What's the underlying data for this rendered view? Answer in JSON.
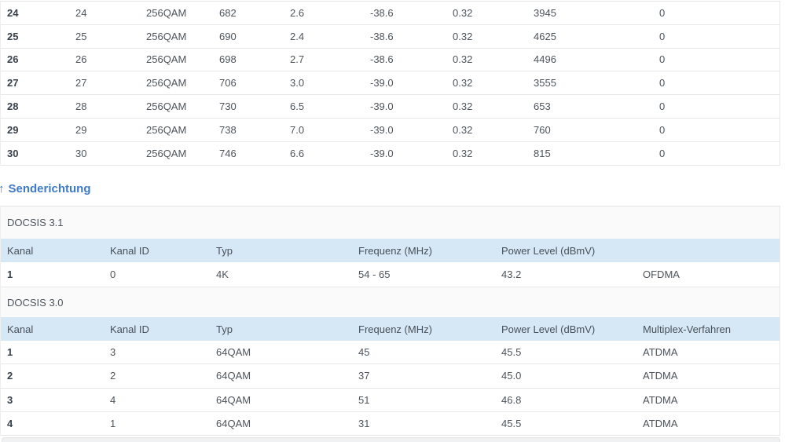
{
  "colors": {
    "table_header_bg": "#d6e8f5",
    "heading_blue": "#3d7ac7"
  },
  "downstream": {
    "rows": [
      [
        "24",
        "24",
        "256QAM",
        "682",
        "2.6",
        "-38.6",
        "0.32",
        "3945",
        "0"
      ],
      [
        "25",
        "25",
        "256QAM",
        "690",
        "2.4",
        "-38.6",
        "0.32",
        "4625",
        "0"
      ],
      [
        "26",
        "26",
        "256QAM",
        "698",
        "2.7",
        "-38.6",
        "0.32",
        "4496",
        "0"
      ],
      [
        "27",
        "27",
        "256QAM",
        "706",
        "3.0",
        "-39.0",
        "0.32",
        "3555",
        "0"
      ],
      [
        "28",
        "28",
        "256QAM",
        "730",
        "6.5",
        "-39.0",
        "0.32",
        "653",
        "0"
      ],
      [
        "29",
        "29",
        "256QAM",
        "738",
        "7.0",
        "-39.0",
        "0.32",
        "760",
        "0"
      ],
      [
        "30",
        "30",
        "256QAM",
        "746",
        "6.6",
        "-39.0",
        "0.32",
        "815",
        "0"
      ]
    ]
  },
  "upstream": {
    "arrow": "↑",
    "heading": "Senderichtung",
    "docsis31": {
      "label": "DOCSIS 3.1",
      "headers": [
        "Kanal",
        "Kanal ID",
        "Typ",
        "Frequenz (MHz)",
        "Power Level (dBmV)",
        ""
      ],
      "rows": [
        [
          "1",
          "0",
          "4K",
          "54 - 65",
          "43.2",
          "OFDMA"
        ]
      ]
    },
    "docsis30": {
      "label": "DOCSIS 3.0",
      "headers": [
        "Kanal",
        "Kanal ID",
        "Typ",
        "Frequenz (MHz)",
        "Power Level (dBmV)",
        "Multiplex-Verfahren"
      ],
      "rows": [
        [
          "1",
          "3",
          "64QAM",
          "45",
          "45.5",
          "ATDMA"
        ],
        [
          "2",
          "2",
          "64QAM",
          "37",
          "45.0",
          "ATDMA"
        ],
        [
          "3",
          "4",
          "64QAM",
          "51",
          "46.8",
          "ATDMA"
        ],
        [
          "4",
          "1",
          "64QAM",
          "31",
          "45.5",
          "ATDMA"
        ]
      ]
    }
  }
}
